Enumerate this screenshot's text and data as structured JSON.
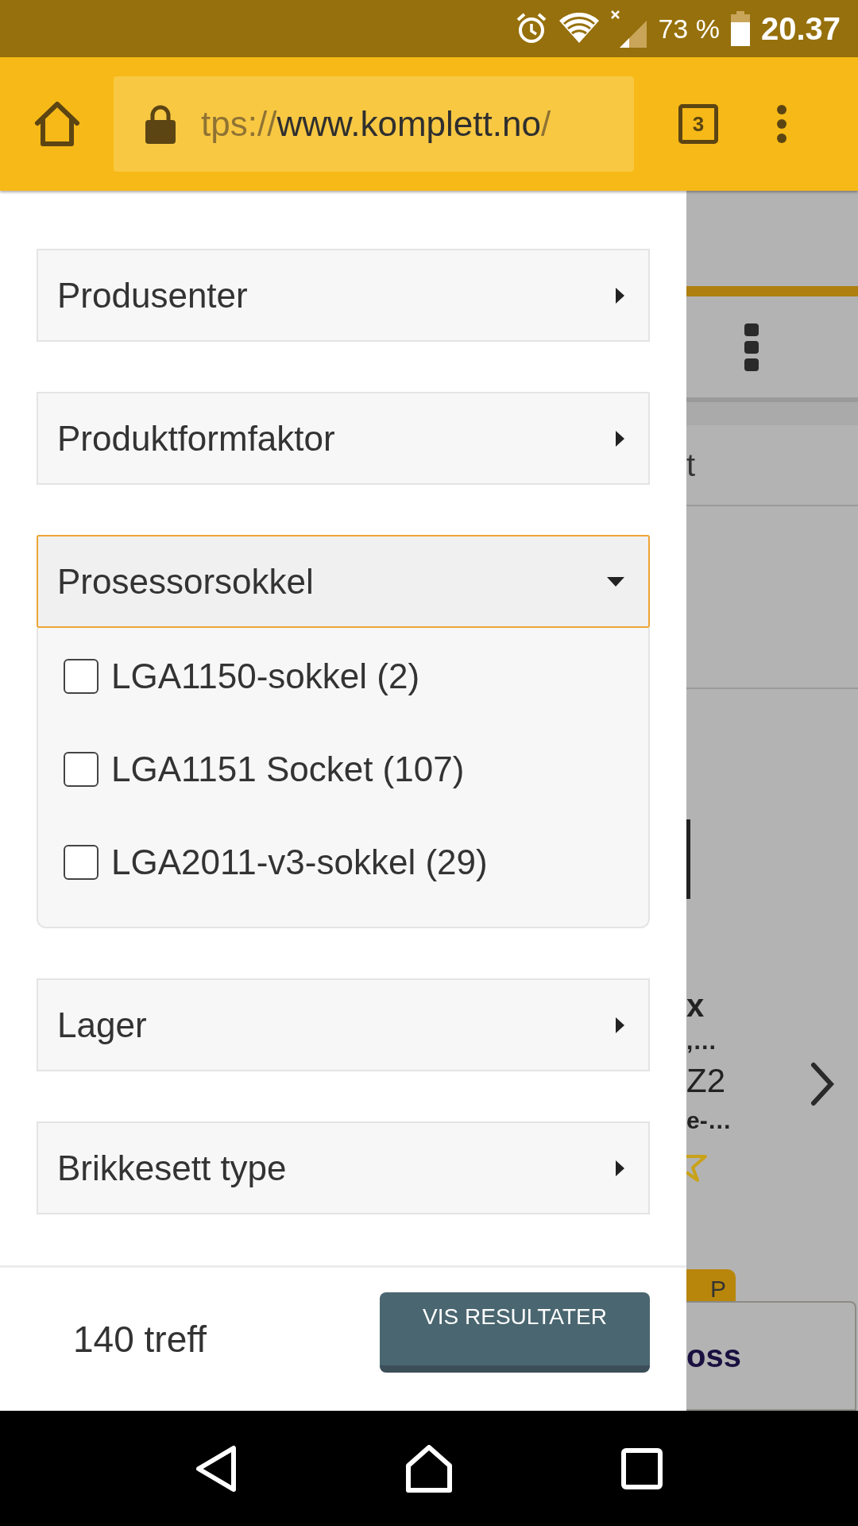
{
  "status_bar": {
    "battery": "73 %",
    "time": "20.37"
  },
  "toolbar": {
    "url": {
      "scheme": "tps://",
      "host": "www.komplett.no",
      "path": "/"
    },
    "tab_count": "3"
  },
  "filters": [
    {
      "label": "Produsenter",
      "expanded": false
    },
    {
      "label": "Produktformfaktor",
      "expanded": false
    },
    {
      "label": "Prosessorsokkel",
      "expanded": true,
      "options": [
        {
          "label": "LGA1150-sokkel (2)",
          "checked": false
        },
        {
          "label": "LGA1151 Socket (107)",
          "checked": false
        },
        {
          "label": "LGA2011-v3-sokkel (29)",
          "checked": false
        }
      ]
    },
    {
      "label": "Lager",
      "expanded": false
    },
    {
      "label": "Brikkesett type",
      "expanded": false
    }
  ],
  "footer": {
    "hits": "140 treff",
    "button": "VIS RESULTATER"
  },
  "background_page": {
    "row_text": "t",
    "product_title": "x",
    "product_line_1": ",…",
    "product_model": "Z2",
    "product_line_2": "e-…",
    "badge": "P",
    "card_text": "oss"
  }
}
